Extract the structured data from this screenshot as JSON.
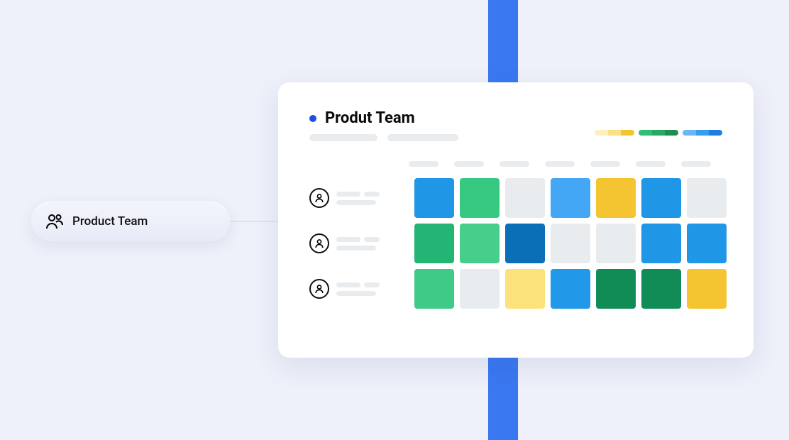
{
  "pill": {
    "label": "Product Team"
  },
  "card": {
    "title": "Produt Team",
    "legend": [
      [
        "#fdf0bf",
        "#fbe08a",
        "#f4c430"
      ],
      [
        "#2fbf71",
        "#28a862",
        "#1e8e52"
      ],
      [
        "#6cb6f5",
        "#359eee",
        "#1f7de0"
      ]
    ],
    "rows": [
      {
        "cells": [
          "#1f97e6",
          "#37c882",
          "#e9ecef",
          "#43a7f5",
          "#f5c531",
          "#1f97e6",
          "#e9ecef"
        ]
      },
      {
        "cells": [
          "#22b573",
          "#45cf8b",
          "#0b6fb8",
          "#e9ecef",
          "#e9ecef",
          "#1f97e6",
          "#1f97e6"
        ]
      },
      {
        "cells": [
          "#3fca87",
          "#e9ecef",
          "#fbe27a",
          "#2198e8",
          "#118c57",
          "#118c57",
          "#f5c531"
        ]
      }
    ]
  }
}
